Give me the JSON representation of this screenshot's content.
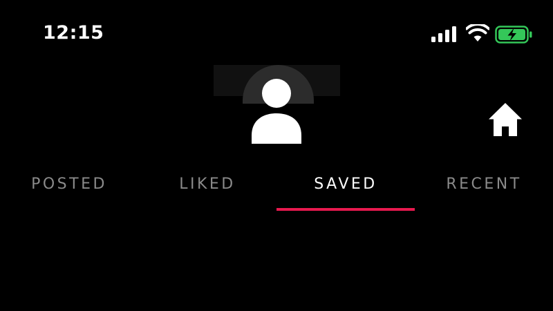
{
  "status_bar": {
    "time": "12:15",
    "signal_icon": "cellular-signal-icon",
    "wifi_icon": "wifi-icon",
    "battery_icon": "battery-charging-icon",
    "battery_color": "#34c759"
  },
  "profile": {
    "avatar_icon": "person-icon",
    "home_icon": "home-icon"
  },
  "tabs": [
    {
      "label": "POSTED",
      "active": false
    },
    {
      "label": "LIKED",
      "active": false
    },
    {
      "label": "SAVED",
      "active": true
    },
    {
      "label": "RECENT",
      "active": false
    }
  ],
  "colors": {
    "background": "#000000",
    "active_tab_text": "#ffffff",
    "inactive_tab_text": "#8a8a8a",
    "tab_indicator": "#e8194f"
  }
}
